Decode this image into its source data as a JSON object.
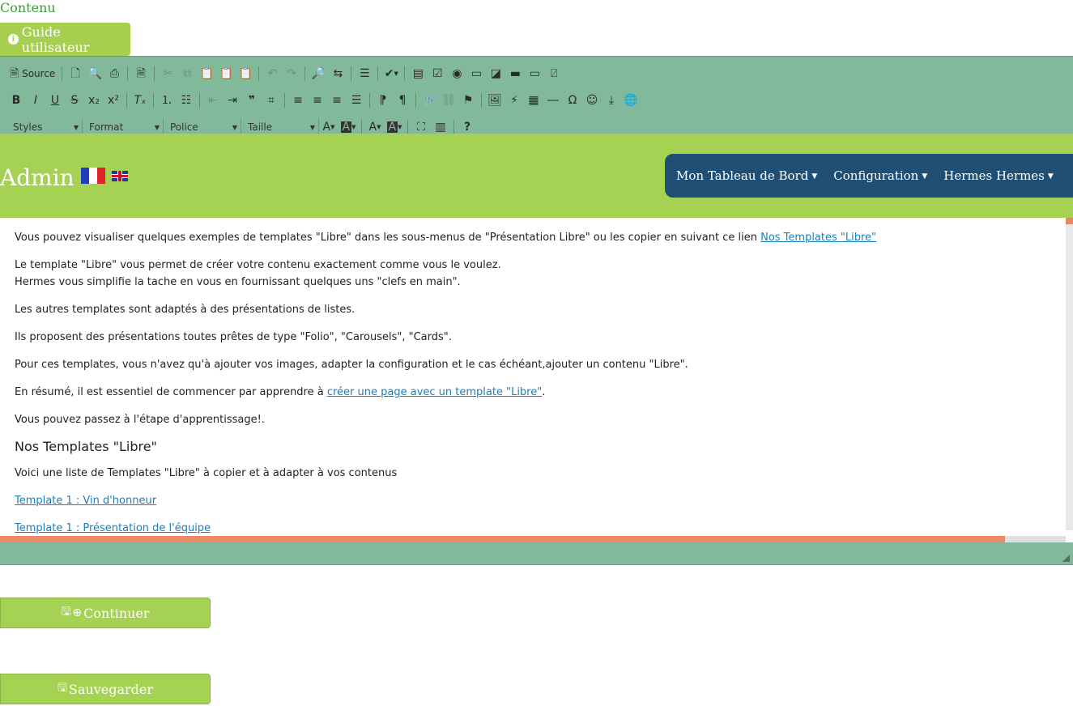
{
  "page": {
    "section_label": "Contenu",
    "guide_button": "Guide utilisateur"
  },
  "toolbar": {
    "source_label": "Source",
    "combos": [
      {
        "label": "Styles"
      },
      {
        "label": "Format"
      },
      {
        "label": "Police"
      },
      {
        "label": "Taille"
      }
    ]
  },
  "banner": {
    "title": "Admin",
    "nav": [
      {
        "label": "Mon Tableau de Bord"
      },
      {
        "label": "Configuration"
      },
      {
        "label": "Hermes Hermes"
      }
    ]
  },
  "content": {
    "p1_text": "Vous pouvez visualiser quelques exemples de templates \"Libre\" dans les sous-menus de \"Présentation Libre\" ou les copier en suivant ce lien ",
    "p1_link": "Nos Templates \"Libre\"",
    "p2_line1": "Le template \"Libre\" vous permet de créer votre contenu exactement comme vous le voulez.",
    "p2_line2": "Hermes vous simplifie la tache en vous en fournissant quelques uns \"clefs en main\".",
    "p3": "Les autres templates sont adaptés à des présentations de listes.",
    "p4": "Ils proposent des présentations toutes prêtes de type \"Folio\", \"Carousels\", \"Cards\".",
    "p5": "Pour ces templates, vous n'avez qu'à ajouter vos images, adapter la configuration et le cas échéant,ajouter un contenu \"Libre\".",
    "p6_text": "En résumé, il est essentiel de commencer par apprendre à ",
    "p6_link": "créer une page avec un template \"Libre\"",
    "p6_end": ".",
    "p7": "Vous pouvez passez à l'étape d'apprentissage!.",
    "heading": "Nos Templates \"Libre\"",
    "p8": "Voici une liste de Templates \"Libre\" à copier et à adapter à vos contenus",
    "link1": "Template 1 : Vin d'honneur",
    "link2": "Template 1 : Présentation de l'équipe"
  },
  "actions": {
    "continue_label": "Continuer",
    "save_label": "Sauvegarder"
  },
  "colors": {
    "accent_green": "#a6d253",
    "toolbar_green": "#82b99a",
    "nav_blue": "#1f4f74",
    "link_blue": "#1a7fbd"
  }
}
